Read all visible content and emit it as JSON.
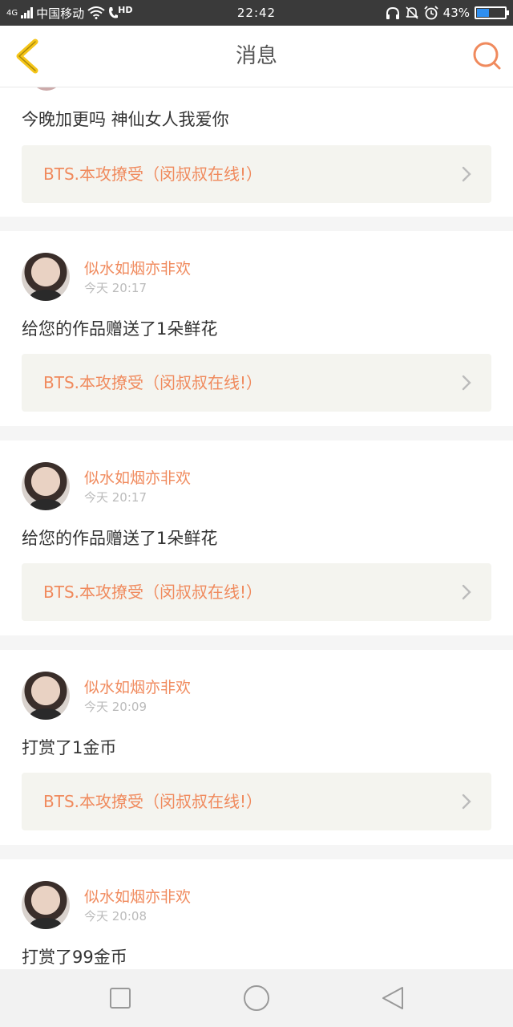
{
  "status_bar": {
    "network": "4G",
    "carrier": "中国移动",
    "hd": "HD",
    "time": "22:42",
    "battery": "43%",
    "battery_level": 0.43
  },
  "header": {
    "title": "消息",
    "back_icon": "chevron-left-icon",
    "search_icon": "search-icon"
  },
  "messages": [
    {
      "text": "今晚加更吗 神仙女人我爱你",
      "book": "BTS.本攻撩受（闵叔叔在线!）"
    },
    {
      "user": "似水如烟亦非欢",
      "time": "今天 20:17",
      "text": "给您的作品赠送了1朵鲜花",
      "book": "BTS.本攻撩受（闵叔叔在线!）"
    },
    {
      "user": "似水如烟亦非欢",
      "time": "今天 20:17",
      "text": "给您的作品赠送了1朵鲜花",
      "book": "BTS.本攻撩受（闵叔叔在线!）"
    },
    {
      "user": "似水如烟亦非欢",
      "time": "今天 20:09",
      "text": "打赏了1金币",
      "book": "BTS.本攻撩受（闵叔叔在线!）"
    },
    {
      "user": "似水如烟亦非欢",
      "time": "今天 20:08",
      "text": "打赏了99金币"
    }
  ],
  "colors": {
    "accent": "#f08a5d",
    "back_arrow": "#f5c518",
    "card_bg": "#f4f4ef",
    "status_bar": "#3a3a3a"
  },
  "bottom_nav": {
    "icons": [
      "square-icon",
      "circle-icon",
      "triangle-back-icon"
    ]
  }
}
